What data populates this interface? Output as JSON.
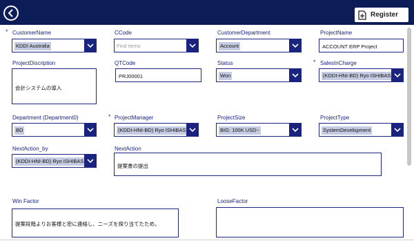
{
  "header": {
    "register_label": "Register"
  },
  "fields": {
    "customer_name": {
      "label": "CustomerName",
      "value": "KDDI Australia"
    },
    "ccode": {
      "label": "CCode",
      "placeholder": "Find items"
    },
    "customer_department": {
      "label": "CustomerDepartment",
      "value": "Account"
    },
    "project_name": {
      "label": "ProjectName",
      "value": "ACCOUNT ERP Project"
    },
    "project_discription": {
      "label": "ProjectDiscription",
      "value": "会計システムの導入"
    },
    "qtcode": {
      "label": "QTCode",
      "value": "PRJ00001"
    },
    "status": {
      "label": "Status",
      "value": "Won"
    },
    "sales_in_charge": {
      "label": "SalesInCharge",
      "value": "(KDDI-HNI-BD) Ryo ISHIBASHI"
    },
    "department": {
      "label": "Department (Department0)",
      "value": "BD"
    },
    "project_manager": {
      "label": "ProjectManager",
      "value": "(KDDI-HNI-BD) Ryo ISHIBASHI"
    },
    "project_size": {
      "label": "ProjectSize",
      "value": "BIG: 100K USD~"
    },
    "project_type": {
      "label": "ProjectType",
      "value": "SystemDevelopment"
    },
    "next_action_by": {
      "label": "NextAction_by",
      "value": "(KDDI-HNI-BD) Ryo ISHIBASHI"
    },
    "next_action": {
      "label": "NextAction",
      "value": "提案書の提出"
    },
    "win_factor": {
      "label": "Win Factor",
      "value": "提案段階よりお客様と密に連絡し、ニーズを探り当てたため。"
    },
    "loose_factor": {
      "label": "LooseFactor",
      "value": ""
    }
  },
  "required_marker": "*",
  "colors": {
    "header": "#0c1c56",
    "accent": "#1a237e",
    "selection": "#c5cbe0"
  },
  "icons": {
    "back": "chevron-left-icon",
    "register": "add-document-icon",
    "dropdown": "chevron-down-icon"
  }
}
